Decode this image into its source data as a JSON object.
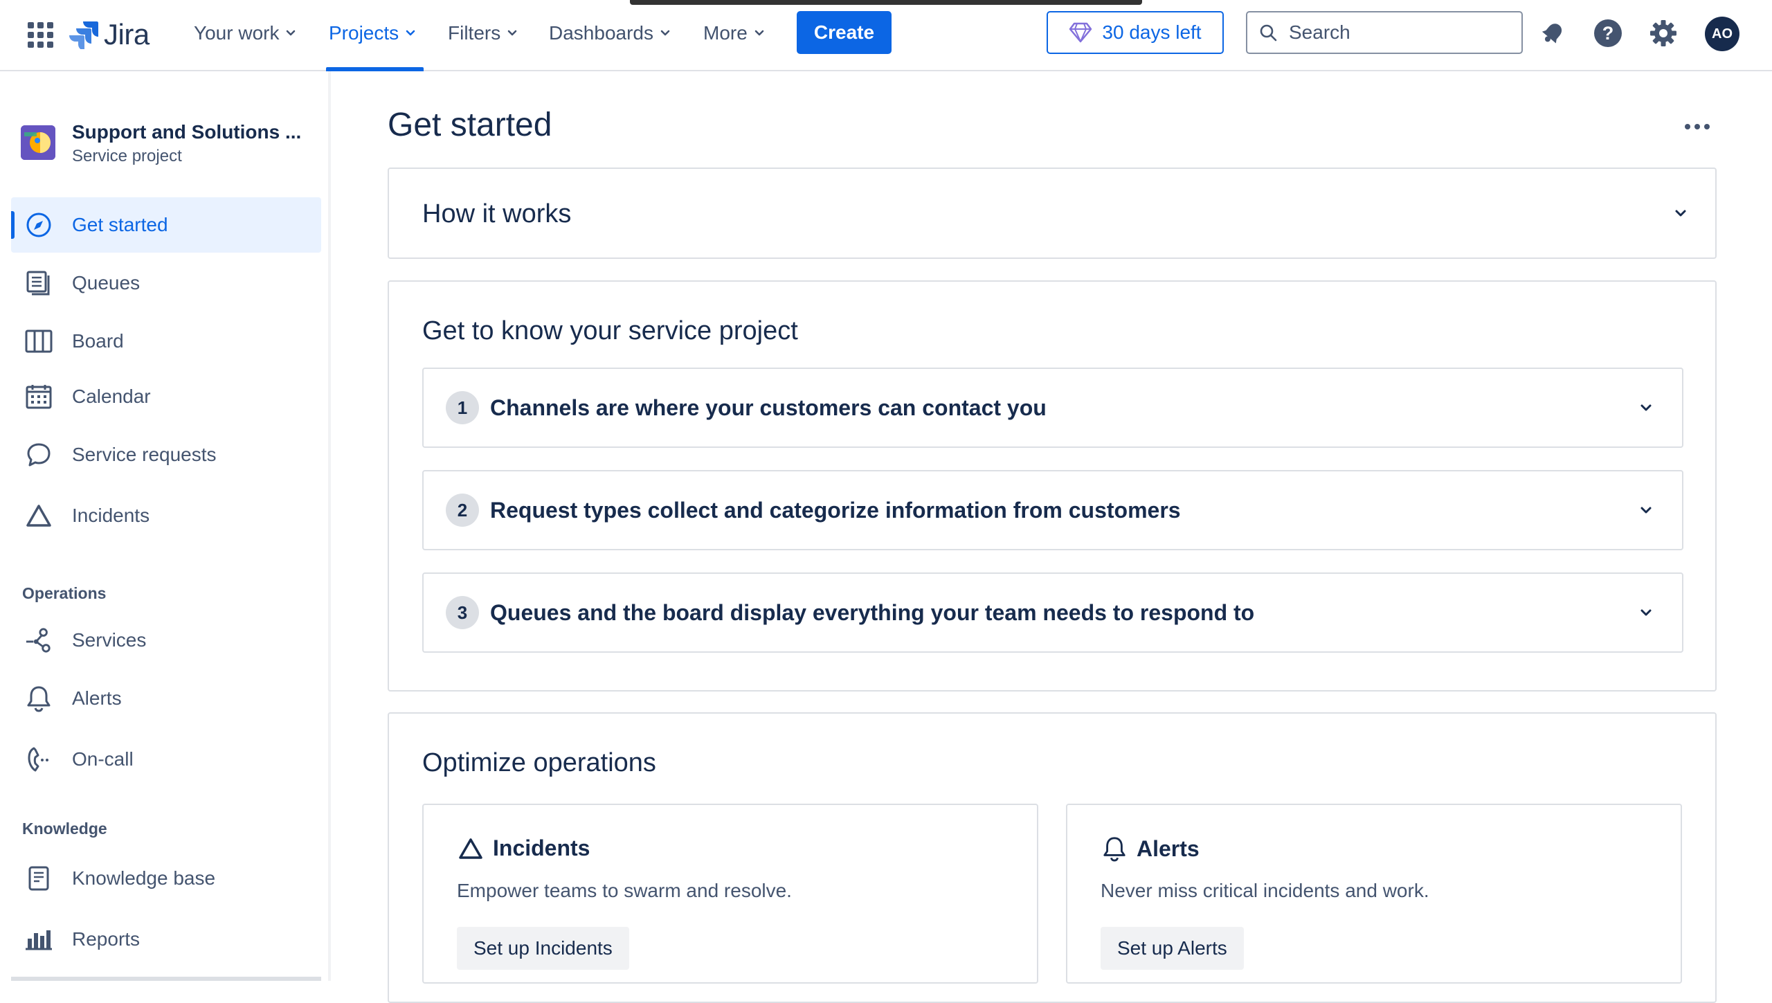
{
  "topnav": {
    "app_switcher_icon": "grid-icon",
    "logo_text": "Jira",
    "items": [
      {
        "label": "Your work"
      },
      {
        "label": "Projects"
      },
      {
        "label": "Filters"
      },
      {
        "label": "Dashboards"
      },
      {
        "label": "More"
      }
    ],
    "active_item": "Projects",
    "create_label": "Create",
    "trial_label": "30 days left",
    "search_placeholder": "Search",
    "avatar_initials": "AO",
    "accent_color": "#0C66E4"
  },
  "sidebar": {
    "project_name": "Support and Solutions ...",
    "project_type": "Service project",
    "items": [
      {
        "label": "Get started",
        "icon": "compass-icon"
      },
      {
        "label": "Queues",
        "icon": "queues-icon"
      },
      {
        "label": "Board",
        "icon": "board-icon"
      },
      {
        "label": "Calendar",
        "icon": "calendar-icon"
      },
      {
        "label": "Service requests",
        "icon": "speech-bubble-icon"
      },
      {
        "label": "Incidents",
        "icon": "triangle-icon"
      }
    ],
    "operations_heading": "Operations",
    "operations_items": [
      {
        "label": "Services",
        "icon": "services-icon"
      },
      {
        "label": "Alerts",
        "icon": "bell-icon"
      },
      {
        "label": "On-call",
        "icon": "phone-icon"
      }
    ],
    "knowledge_heading": "Knowledge",
    "knowledge_items": [
      {
        "label": "Knowledge base",
        "icon": "book-icon"
      },
      {
        "label": "Reports",
        "icon": "bar-chart-icon"
      }
    ]
  },
  "main": {
    "title": "Get started",
    "how_it_works": "How it works",
    "know_heading": "Get to know your service project",
    "steps": [
      {
        "num": "1",
        "text": "Channels are where your customers can contact you"
      },
      {
        "num": "2",
        "text": "Request types collect and categorize information from customers"
      },
      {
        "num": "3",
        "text": "Queues and the board display everything your team needs to respond to"
      }
    ],
    "optimize_heading": "Optimize operations",
    "features": [
      {
        "title": "Incidents",
        "icon": "triangle-icon",
        "desc": "Empower teams to swarm and resolve.",
        "button": "Set up Incidents"
      },
      {
        "title": "Alerts",
        "icon": "bell-icon",
        "desc": "Never miss critical incidents and work.",
        "button": "Set up Alerts"
      }
    ]
  }
}
